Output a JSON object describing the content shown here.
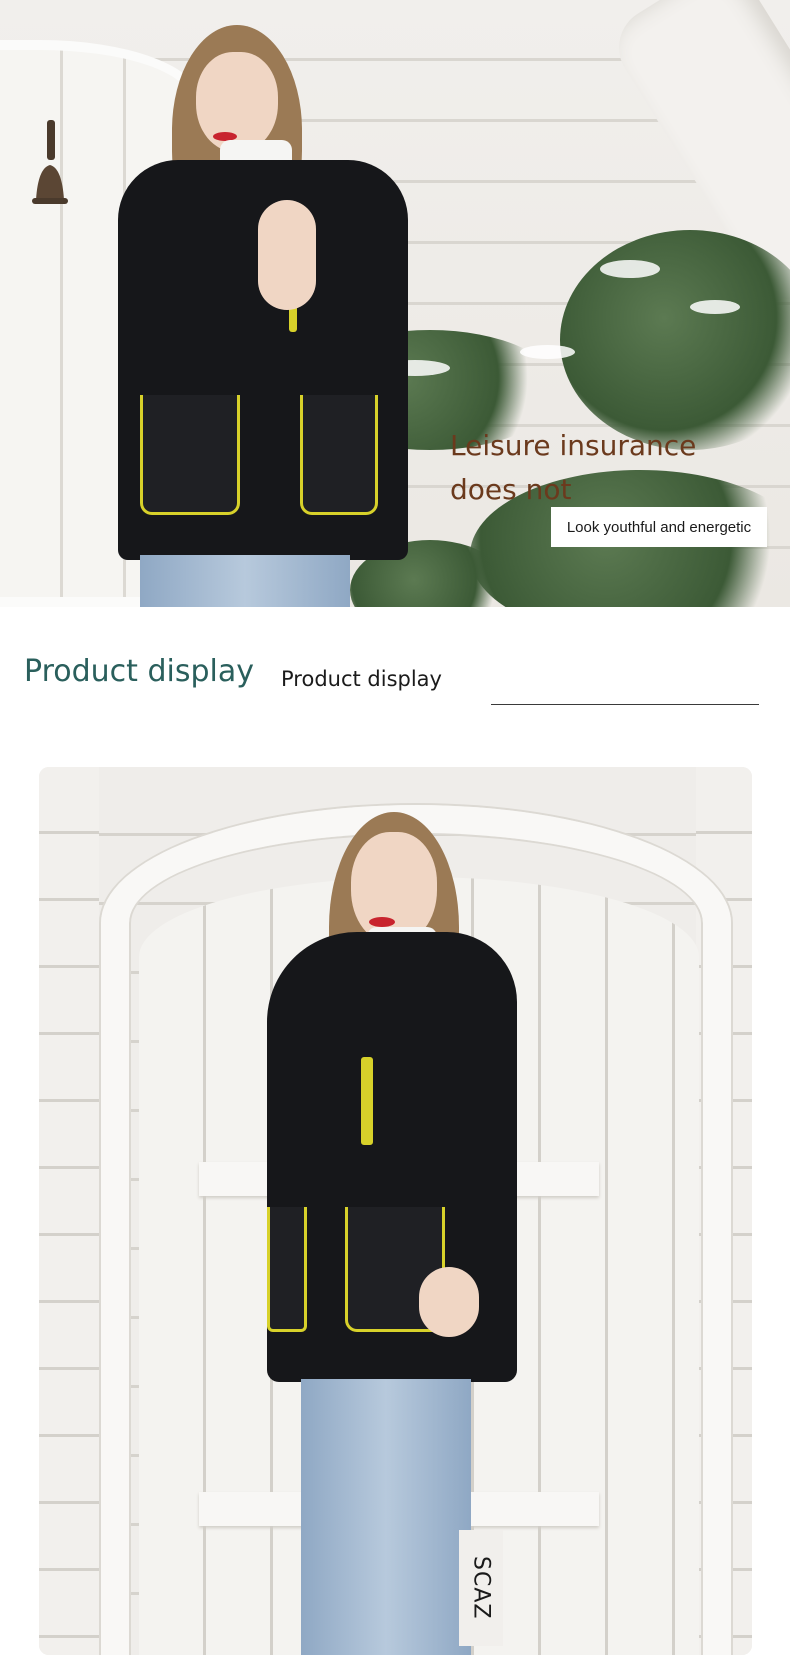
{
  "hero": {
    "title_line1": "Leisure insurance",
    "title_line2": "does not",
    "tagline": "Look youthful and energetic"
  },
  "section": {
    "title": "Product display",
    "subtitle": "Product display"
  },
  "product_photo": {
    "brand_mark": "SCAZ"
  },
  "colors": {
    "section_title": "#2a5f5c",
    "hero_title": "#6b3a1d",
    "accent_yellow": "#d7d12a",
    "coat": "#16171a"
  }
}
